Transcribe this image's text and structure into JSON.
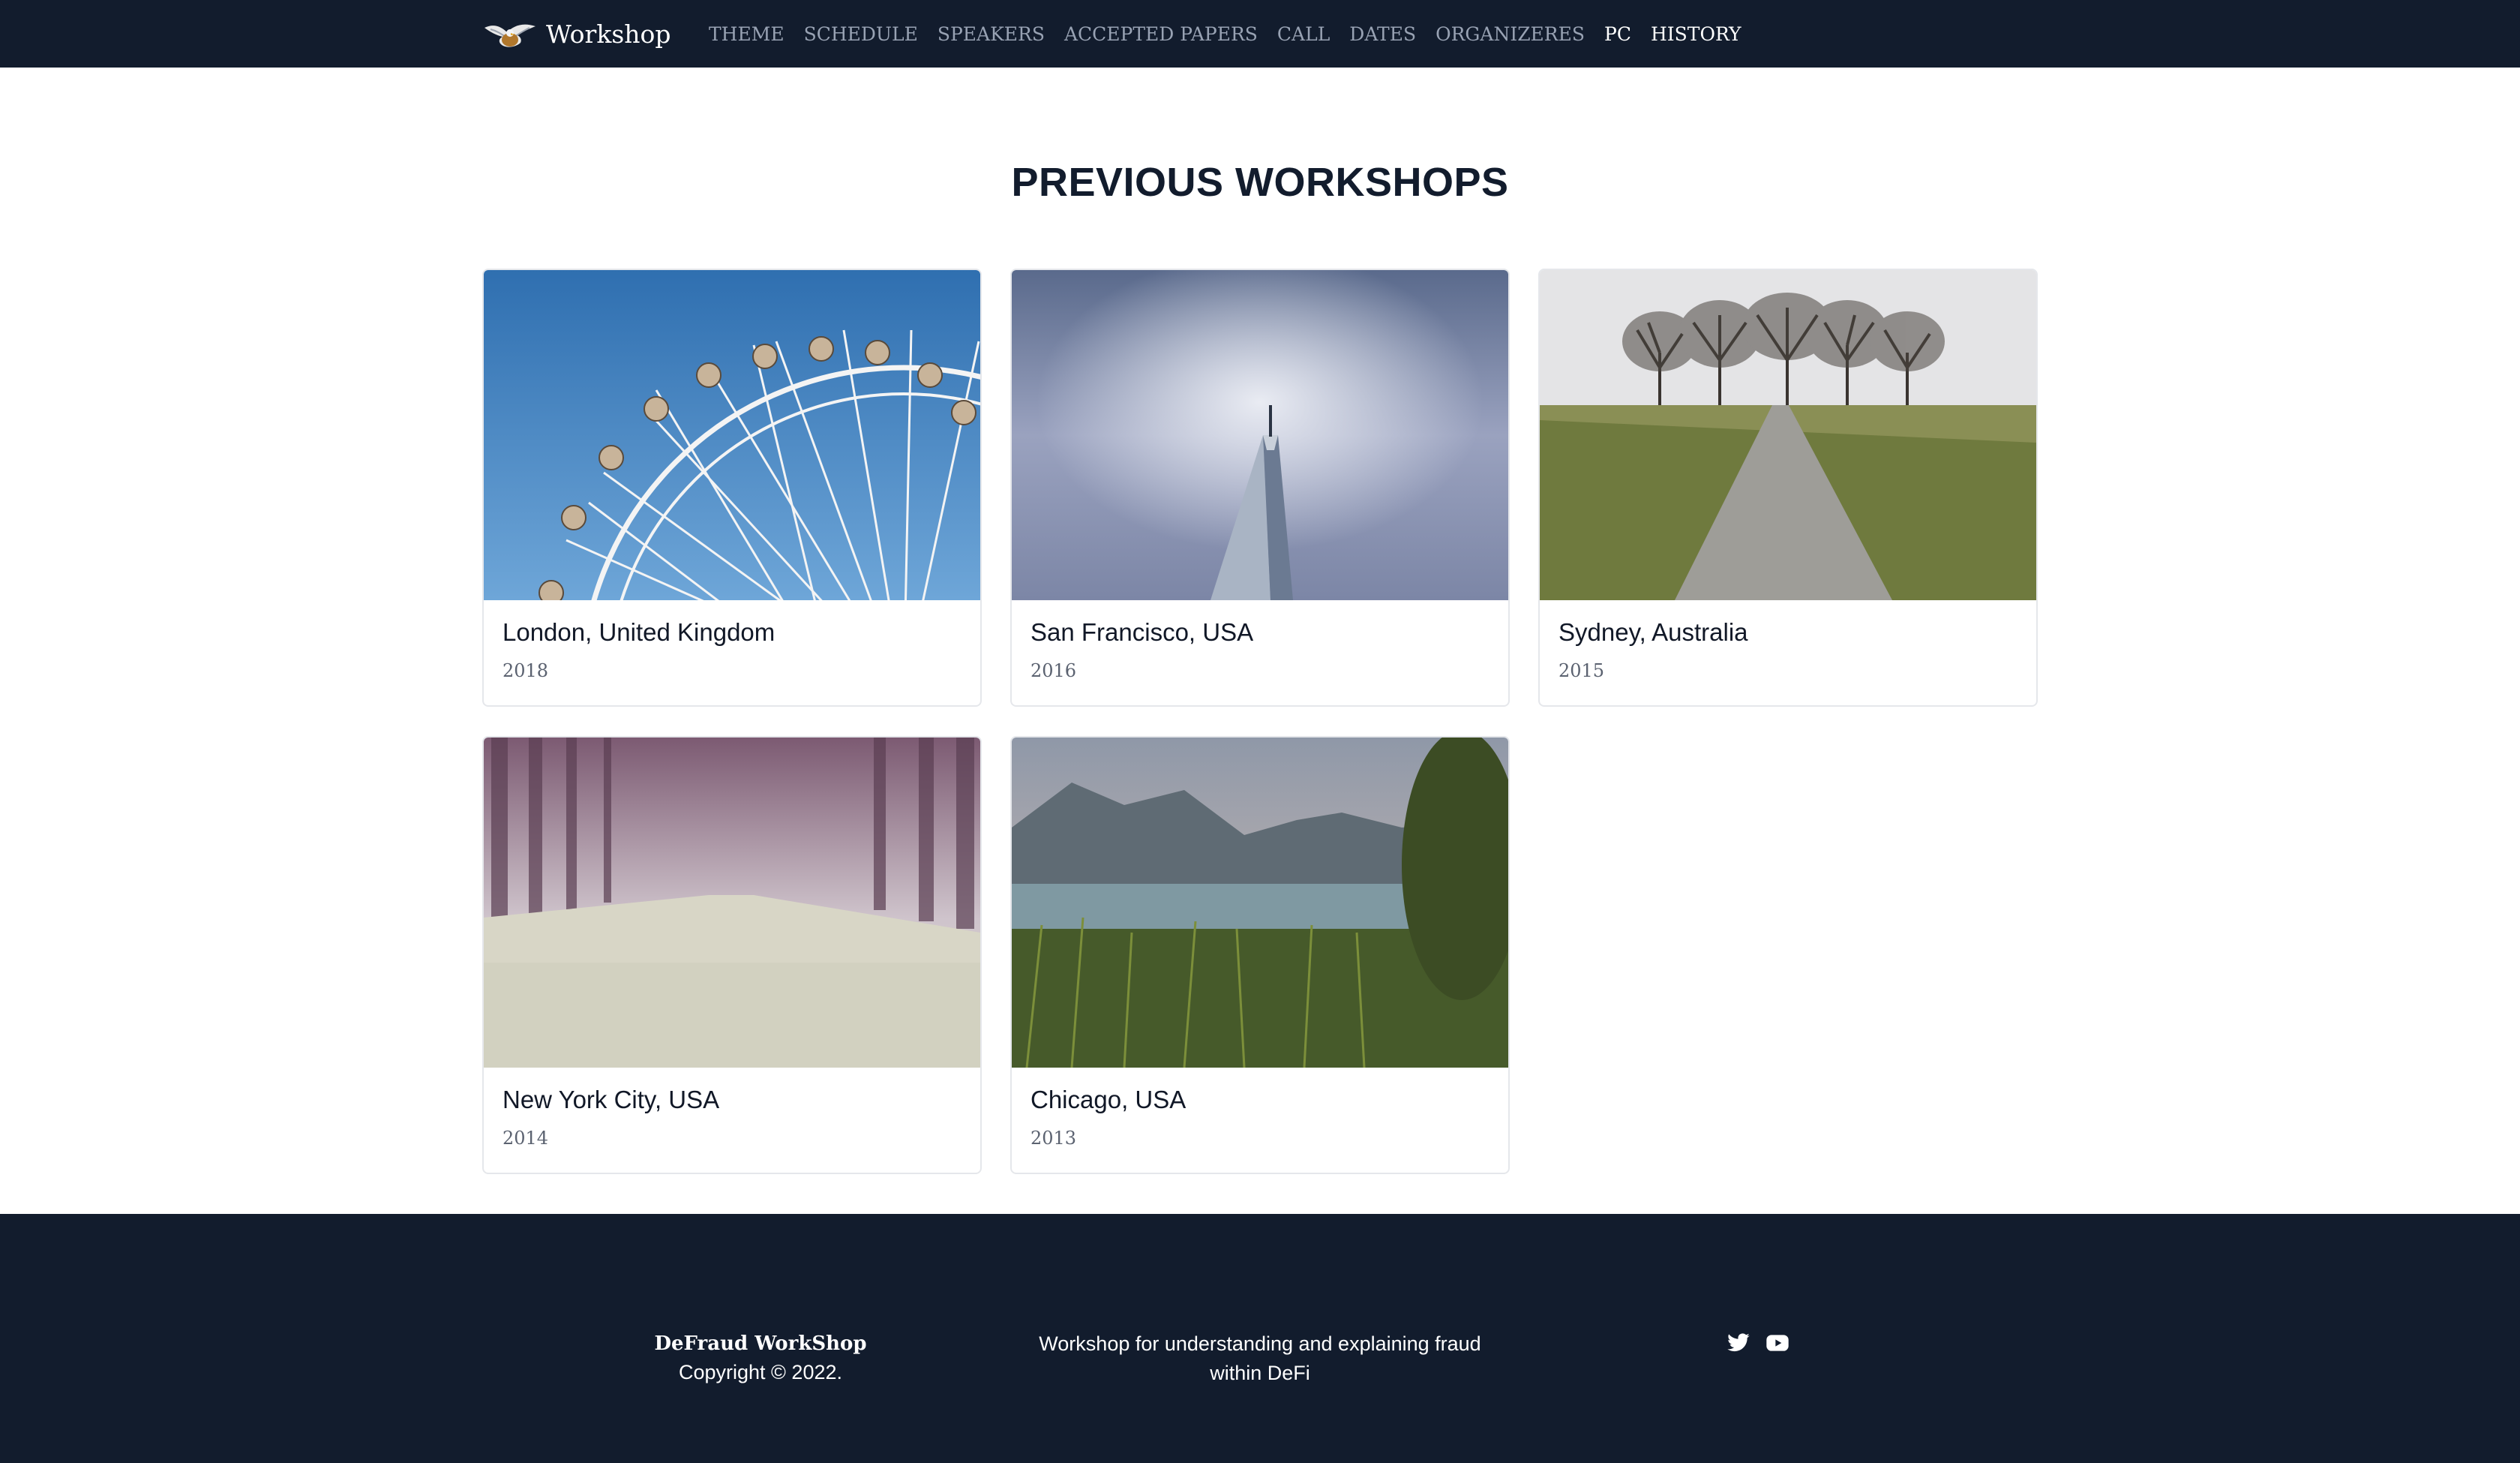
{
  "navbar": {
    "brand": "Workshop",
    "links": [
      {
        "label": "THEME",
        "active": false
      },
      {
        "label": "SCHEDULE",
        "active": false
      },
      {
        "label": "SPEAKERS",
        "active": false
      },
      {
        "label": "ACCEPTED PAPERS",
        "active": false
      },
      {
        "label": "CALL",
        "active": false
      },
      {
        "label": "DATES",
        "active": false
      },
      {
        "label": "ORGANIZERES",
        "active": false
      },
      {
        "label": "PC",
        "active": true
      },
      {
        "label": "HISTORY",
        "active": true
      }
    ]
  },
  "section": {
    "title": "PREVIOUS WORKSHOPS"
  },
  "workshops": [
    {
      "city": "London, United Kingdom",
      "year": "2018",
      "image": "ferris-wheel-photo"
    },
    {
      "city": "San Francisco, USA",
      "year": "2016",
      "image": "skyscraper-clouds-photo"
    },
    {
      "city": "Sydney, Australia",
      "year": "2015",
      "image": "path-trees-field-photo"
    },
    {
      "city": "New York City, USA",
      "year": "2014",
      "image": "misty-forest-road-photo"
    },
    {
      "city": "Chicago, USA",
      "year": "2013",
      "image": "lake-mountains-photo"
    }
  ],
  "footer": {
    "name": "DeFraud WorkShop",
    "copyright": "Copyright © 2022.",
    "description": "Workshop for understanding and explaining fraud within DeFi",
    "social": [
      "twitter-icon",
      "youtube-icon"
    ]
  },
  "colors": {
    "navbar_bg": "#121c2d",
    "footer_bg": "#121c2d",
    "nav_inactive": "#98a2b3",
    "nav_active": "#ffffff"
  }
}
